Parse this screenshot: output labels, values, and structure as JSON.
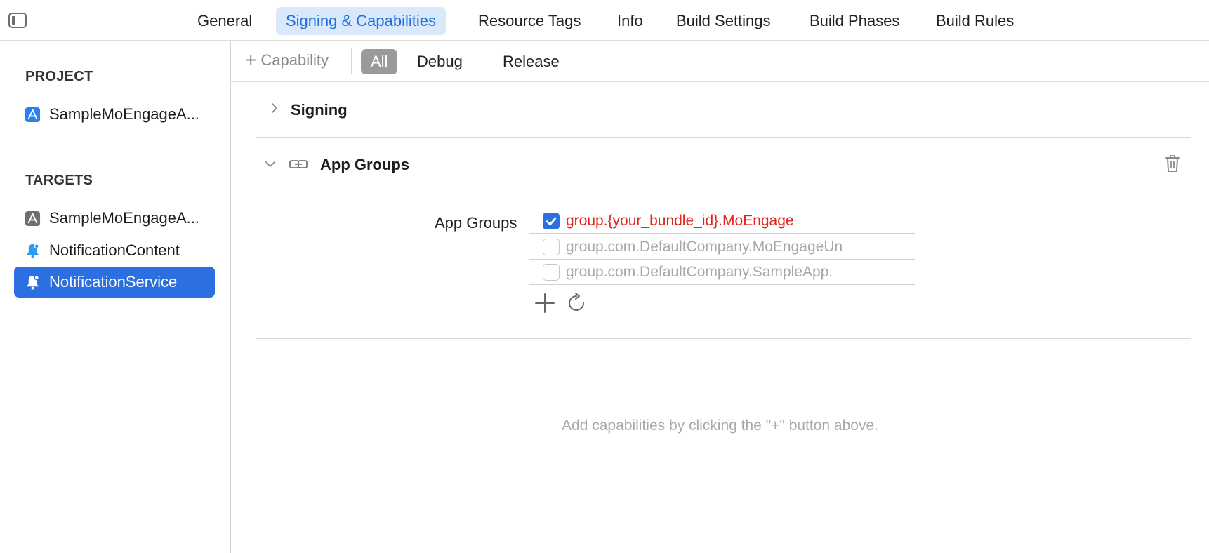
{
  "tabs": [
    {
      "label": "General",
      "active": false
    },
    {
      "label": "Signing & Capabilities",
      "active": true
    },
    {
      "label": "Resource Tags",
      "active": false
    },
    {
      "label": "Info",
      "active": false
    },
    {
      "label": "Build Settings",
      "active": false
    },
    {
      "label": "Build Phases",
      "active": false
    },
    {
      "label": "Build Rules",
      "active": false
    }
  ],
  "sidebar": {
    "project_heading": "PROJECT",
    "project_item": "SampleMoEngageA...",
    "targets_heading": "TARGETS",
    "targets": [
      {
        "label": "SampleMoEngageA...",
        "icon": "app-target-icon",
        "selected": false
      },
      {
        "label": "NotificationContent",
        "icon": "bell-icon",
        "selected": false
      },
      {
        "label": "NotificationService",
        "icon": "bell-icon",
        "selected": true
      }
    ]
  },
  "toolbar": {
    "add_capability": "Capability",
    "filters": [
      {
        "label": "All",
        "active": true
      },
      {
        "label": "Debug",
        "active": false
      },
      {
        "label": "Release",
        "active": false
      }
    ]
  },
  "capabilities": {
    "signing_title": "Signing",
    "app_groups_title": "App Groups",
    "app_groups_field_label": "App Groups",
    "groups": [
      {
        "id": "group.{your_bundle_id}.MoEngage",
        "checked": true
      },
      {
        "id": "group.com.DefaultCompany.MoEngageUn",
        "checked": false
      },
      {
        "id": "group.com.DefaultCompany.SampleApp.",
        "checked": false
      }
    ]
  },
  "hint": "Add capabilities by clicking the \"+\" button above.",
  "colors": {
    "accent": "#2b6fe0",
    "active_tab_bg": "#d9e8fb",
    "enabled_group_text": "#e0261b"
  }
}
